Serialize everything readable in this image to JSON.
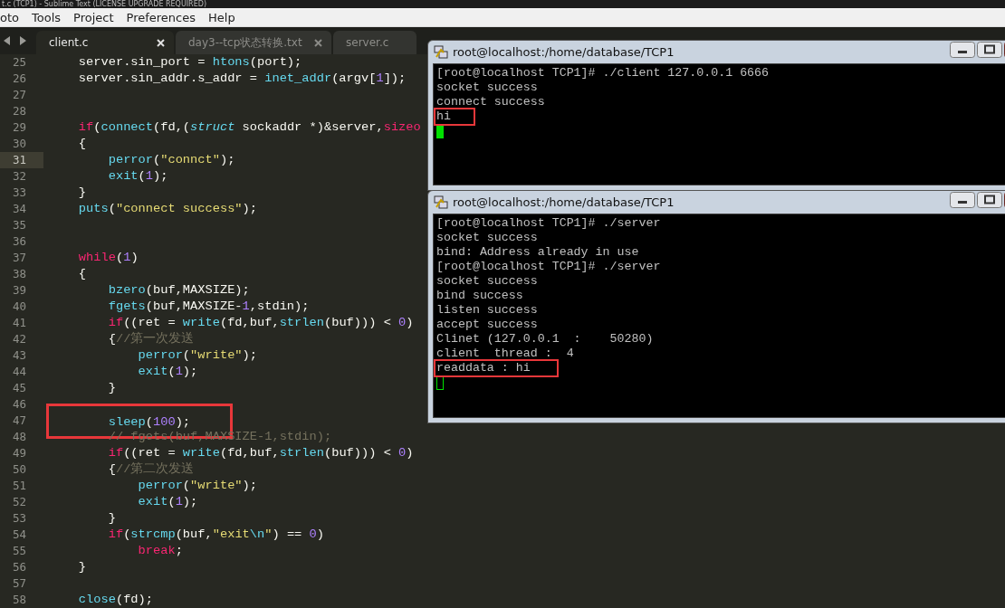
{
  "window": {
    "title": "t.c (TCP1) - Sublime Text (LICENSE UPGRADE REQUIRED)"
  },
  "menu": [
    "oto",
    "Tools",
    "Project",
    "Preferences",
    "Help"
  ],
  "tabs": [
    {
      "label": "client.c",
      "selected": true,
      "closable": true
    },
    {
      "label": "day3--tcp状态转换.txt",
      "selected": false,
      "closable": true
    },
    {
      "label": "server.c",
      "selected": false,
      "closable": false
    }
  ],
  "editor": {
    "lines": [
      {
        "number": "25",
        "current": false,
        "tokens": [
          {
            "kind": "plain",
            "text": "    server.sin_port = "
          },
          {
            "kind": "fn",
            "text": "htons"
          },
          {
            "kind": "plain",
            "text": "(port);"
          }
        ]
      },
      {
        "number": "26",
        "current": false,
        "tokens": [
          {
            "kind": "plain",
            "text": "    server.sin_addr.s_addr = "
          },
          {
            "kind": "fn",
            "text": "inet_addr"
          },
          {
            "kind": "plain",
            "text": "(argv["
          },
          {
            "kind": "num",
            "text": "1"
          },
          {
            "kind": "plain",
            "text": "]);"
          }
        ]
      },
      {
        "number": "27",
        "current": false
      },
      {
        "number": "28",
        "current": false
      },
      {
        "number": "29",
        "current": false,
        "tokens": [
          {
            "kind": "kw",
            "text": "    if"
          },
          {
            "kind": "plain",
            "text": "("
          },
          {
            "kind": "fn",
            "text": "connect"
          },
          {
            "kind": "plain",
            "text": "(fd,("
          },
          {
            "kind": "type",
            "text": "struct"
          },
          {
            "kind": "plain",
            "text": " sockaddr *)&server,"
          },
          {
            "kind": "kw",
            "text": "sizeo"
          }
        ]
      },
      {
        "number": "30",
        "current": false,
        "tokens": [
          {
            "kind": "plain",
            "text": "    {"
          }
        ]
      },
      {
        "number": "31",
        "current": true,
        "tokens": [
          {
            "kind": "fn",
            "text": "        perror"
          },
          {
            "kind": "plain",
            "text": "("
          },
          {
            "kind": "str",
            "text": "\"connct\""
          },
          {
            "kind": "plain",
            "text": ");"
          }
        ]
      },
      {
        "number": "32",
        "current": false,
        "tokens": [
          {
            "kind": "fn",
            "text": "        exit"
          },
          {
            "kind": "plain",
            "text": "("
          },
          {
            "kind": "num",
            "text": "1"
          },
          {
            "kind": "plain",
            "text": ");"
          }
        ]
      },
      {
        "number": "33",
        "current": false,
        "tokens": [
          {
            "kind": "plain",
            "text": "    }"
          }
        ]
      },
      {
        "number": "34",
        "current": false,
        "tokens": [
          {
            "kind": "fn",
            "text": "    puts"
          },
          {
            "kind": "plain",
            "text": "("
          },
          {
            "kind": "str",
            "text": "\"connect success\""
          },
          {
            "kind": "plain",
            "text": ");"
          }
        ]
      },
      {
        "number": "35",
        "current": false
      },
      {
        "number": "36",
        "current": false
      },
      {
        "number": "37",
        "current": false,
        "tokens": [
          {
            "kind": "kw",
            "text": "    while"
          },
          {
            "kind": "plain",
            "text": "("
          },
          {
            "kind": "num",
            "text": "1"
          },
          {
            "kind": "plain",
            "text": ")"
          }
        ]
      },
      {
        "number": "38",
        "current": false,
        "tokens": [
          {
            "kind": "plain",
            "text": "    {"
          }
        ]
      },
      {
        "number": "39",
        "current": false,
        "tokens": [
          {
            "kind": "fn",
            "text": "        bzero"
          },
          {
            "kind": "plain",
            "text": "(buf,MAXSIZE);"
          }
        ]
      },
      {
        "number": "40",
        "current": false,
        "tokens": [
          {
            "kind": "fn",
            "text": "        fgets"
          },
          {
            "kind": "plain",
            "text": "(buf,MAXSIZE-"
          },
          {
            "kind": "num",
            "text": "1"
          },
          {
            "kind": "plain",
            "text": ",stdin);"
          }
        ]
      },
      {
        "number": "41",
        "current": false,
        "tokens": [
          {
            "kind": "kw",
            "text": "        if"
          },
          {
            "kind": "plain",
            "text": "((ret = "
          },
          {
            "kind": "fn",
            "text": "write"
          },
          {
            "kind": "plain",
            "text": "(fd,buf,"
          },
          {
            "kind": "fn",
            "text": "strlen"
          },
          {
            "kind": "plain",
            "text": "(buf))) < "
          },
          {
            "kind": "num",
            "text": "0"
          },
          {
            "kind": "plain",
            "text": ")"
          }
        ]
      },
      {
        "number": "42",
        "current": false,
        "tokens": [
          {
            "kind": "plain",
            "text": "        {"
          },
          {
            "kind": "comment",
            "text": "//第一次发送"
          }
        ]
      },
      {
        "number": "43",
        "current": false,
        "tokens": [
          {
            "kind": "fn",
            "text": "            perror"
          },
          {
            "kind": "plain",
            "text": "("
          },
          {
            "kind": "str",
            "text": "\"write\""
          },
          {
            "kind": "plain",
            "text": ");"
          }
        ]
      },
      {
        "number": "44",
        "current": false,
        "tokens": [
          {
            "kind": "fn",
            "text": "            exit"
          },
          {
            "kind": "plain",
            "text": "("
          },
          {
            "kind": "num",
            "text": "1"
          },
          {
            "kind": "plain",
            "text": ");"
          }
        ]
      },
      {
        "number": "45",
        "current": false,
        "tokens": [
          {
            "kind": "plain",
            "text": "        }"
          }
        ]
      },
      {
        "number": "46",
        "current": false
      },
      {
        "number": "47",
        "current": false,
        "boxed": true,
        "tokens": [
          {
            "kind": "fn",
            "text": "        sleep"
          },
          {
            "kind": "plain",
            "text": "("
          },
          {
            "kind": "num",
            "text": "100"
          },
          {
            "kind": "plain",
            "text": ");"
          }
        ]
      },
      {
        "number": "48",
        "current": false,
        "tokens": [
          {
            "kind": "comment",
            "text": "        // fgets(buf,MAXSIZE-1,stdin);"
          }
        ]
      },
      {
        "number": "49",
        "current": false,
        "tokens": [
          {
            "kind": "kw",
            "text": "        if"
          },
          {
            "kind": "plain",
            "text": "((ret = "
          },
          {
            "kind": "fn",
            "text": "write"
          },
          {
            "kind": "plain",
            "text": "(fd,buf,"
          },
          {
            "kind": "fn",
            "text": "strlen"
          },
          {
            "kind": "plain",
            "text": "(buf))) < "
          },
          {
            "kind": "num",
            "text": "0"
          },
          {
            "kind": "plain",
            "text": ")"
          }
        ]
      },
      {
        "number": "50",
        "current": false,
        "tokens": [
          {
            "kind": "plain",
            "text": "        {"
          },
          {
            "kind": "comment",
            "text": "//第二次发送"
          }
        ]
      },
      {
        "number": "51",
        "current": false,
        "tokens": [
          {
            "kind": "fn",
            "text": "            perror"
          },
          {
            "kind": "plain",
            "text": "("
          },
          {
            "kind": "str",
            "text": "\"write\""
          },
          {
            "kind": "plain",
            "text": ");"
          }
        ]
      },
      {
        "number": "52",
        "current": false,
        "tokens": [
          {
            "kind": "fn",
            "text": "            exit"
          },
          {
            "kind": "plain",
            "text": "("
          },
          {
            "kind": "num",
            "text": "1"
          },
          {
            "kind": "plain",
            "text": ");"
          }
        ]
      },
      {
        "number": "53",
        "current": false,
        "tokens": [
          {
            "kind": "plain",
            "text": "        }"
          }
        ]
      },
      {
        "number": "54",
        "current": false,
        "tokens": [
          {
            "kind": "kw",
            "text": "        if"
          },
          {
            "kind": "plain",
            "text": "("
          },
          {
            "kind": "fn",
            "text": "strcmp"
          },
          {
            "kind": "plain",
            "text": "(buf,"
          },
          {
            "kind": "str",
            "text": "\"exit"
          },
          {
            "kind": "fn",
            "text": "\\n"
          },
          {
            "kind": "str",
            "text": "\""
          },
          {
            "kind": "plain",
            "text": ") == "
          },
          {
            "kind": "num",
            "text": "0"
          },
          {
            "kind": "plain",
            "text": ")"
          }
        ]
      },
      {
        "number": "55",
        "current": false,
        "tokens": [
          {
            "kind": "kw",
            "text": "            break"
          },
          {
            "kind": "plain",
            "text": ";"
          }
        ]
      },
      {
        "number": "56",
        "current": false,
        "tokens": [
          {
            "kind": "plain",
            "text": "    }"
          }
        ]
      },
      {
        "number": "57",
        "current": false
      },
      {
        "number": "58",
        "current": false,
        "tokens": [
          {
            "kind": "fn",
            "text": "    close"
          },
          {
            "kind": "plain",
            "text": "(fd);"
          }
        ]
      }
    ]
  },
  "terminals": [
    {
      "title": "root@localhost:/home/database/TCP1",
      "cursor_filled": true,
      "lines": [
        {
          "text": "[root@localhost TCP1]# ./client 127.0.0.1 6666"
        },
        {
          "text": "socket success"
        },
        {
          "text": "connect success"
        },
        {
          "text": "hi",
          "boxed": true
        }
      ]
    },
    {
      "title": "root@localhost:/home/database/TCP1",
      "cursor_filled": false,
      "lines": [
        {
          "text": "[root@localhost TCP1]# ./server"
        },
        {
          "text": "socket success"
        },
        {
          "text": "bind: Address already in use"
        },
        {
          "text": "[root@localhost TCP1]# ./server"
        },
        {
          "text": "socket success"
        },
        {
          "text": "bind success"
        },
        {
          "text": "listen success"
        },
        {
          "text": "accept success"
        },
        {
          "text": "Clinet (127.0.0.1  :    50280)"
        },
        {
          "text": "client  thread :  4"
        },
        {
          "text": "readdata : hi",
          "boxed": true
        }
      ]
    }
  ]
}
